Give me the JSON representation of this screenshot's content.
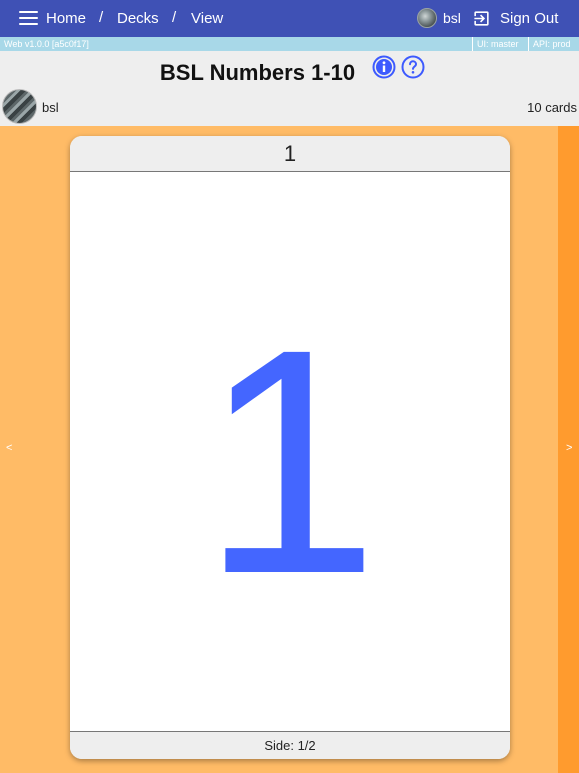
{
  "nav": {
    "breadcrumbs": [
      {
        "label": "Home"
      },
      {
        "label": "Decks"
      },
      {
        "label": "View"
      }
    ],
    "separator": "/",
    "user": "bsl",
    "sign_out": "Sign Out"
  },
  "version": {
    "web": "Web v1.0.0 [a5c0f17]",
    "ui": "UI: master",
    "api": "API: prod"
  },
  "deck": {
    "title": "BSL Numbers 1-10",
    "owner": "bsl",
    "card_count": "10 cards"
  },
  "card": {
    "header": "1",
    "face_text": "1",
    "side": "Side: 1/2",
    "face_color": "#4466ff"
  },
  "pager": {
    "prev": "<",
    "next": ">"
  },
  "colors": {
    "topbar": "#3f51b5",
    "version_strip": "#a8d8e8",
    "stage": "#ffbb66",
    "next_strip": "#ff9b2e",
    "accent_icon": "#3d5afe"
  },
  "icons": {
    "menu": "menu-icon",
    "sign_out": "sign-out-icon",
    "info": "info-icon",
    "help": "help-icon"
  }
}
